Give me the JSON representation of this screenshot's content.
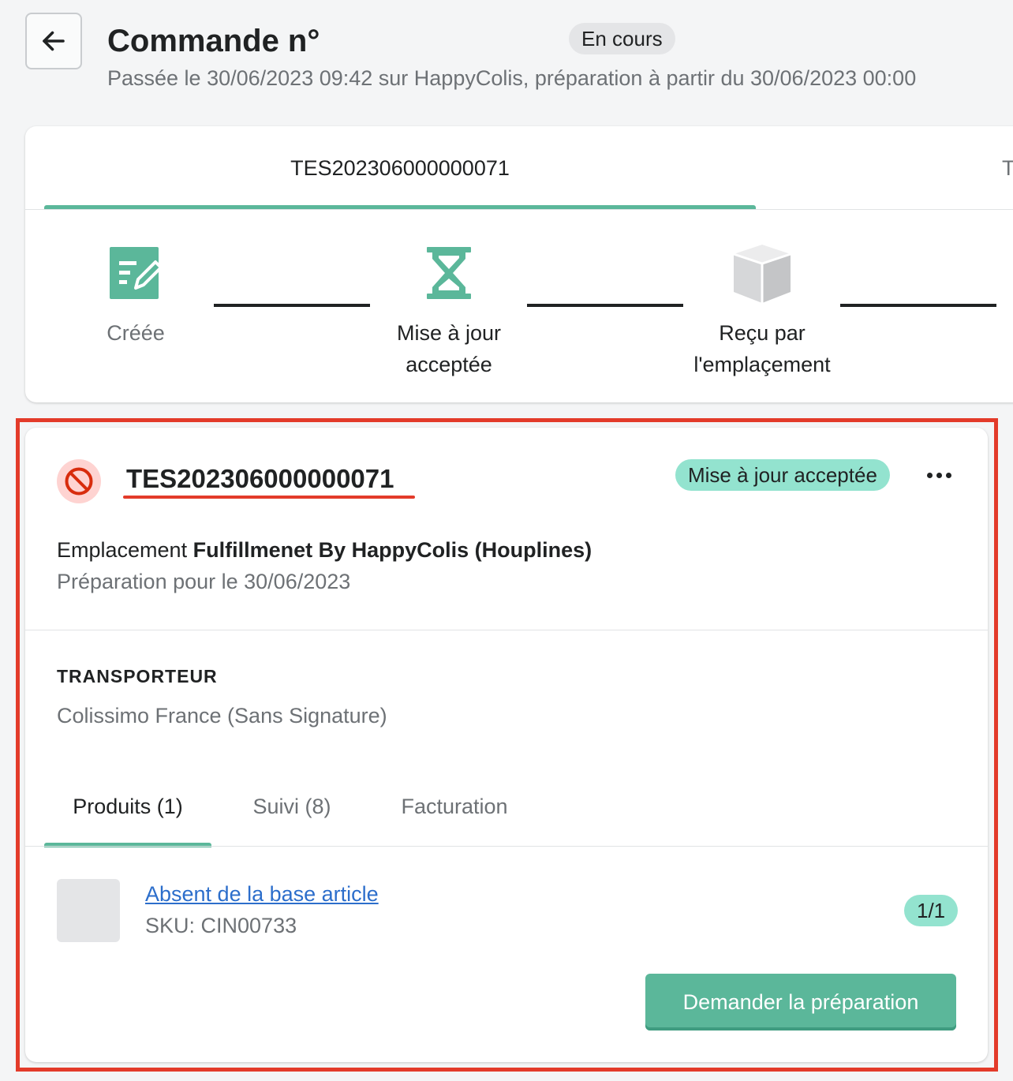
{
  "header": {
    "title": "Commande n°",
    "status_badge": "En cours",
    "subtitle": "Passée le 30/06/2023 09:42 sur HappyColis, préparation à partir du 30/06/2023 00:00"
  },
  "shipment_tabs": [
    {
      "label": "TES202306000000071",
      "active": true
    },
    {
      "label": "T",
      "active": false
    }
  ],
  "progress_steps": [
    {
      "label": "Créée",
      "icon": "edit-note-icon",
      "state": "done"
    },
    {
      "label_line1": "Mise à jour",
      "label_line2": "acceptée",
      "icon": "hourglass-icon",
      "state": "current"
    },
    {
      "label_line1": "Reçu par",
      "label_line2": "l'emplaçement",
      "icon": "package-box-icon",
      "state": "pending"
    }
  ],
  "shipment": {
    "status_icon": "blocked-icon",
    "reference": "TES202306000000071",
    "status_badge": "Mise à jour acceptée",
    "location_prefix": "Emplacement",
    "location_name": "Fulfillmenet By HappyColis (Houplines)",
    "preparation_date": "Préparation pour le 30/06/2023",
    "carrier_heading": "TRANSPORTEUR",
    "carrier_value": "Colissimo France (Sans Signature)",
    "tabs": [
      {
        "label": "Produits (1)",
        "active": true
      },
      {
        "label": "Suivi (8)",
        "active": false
      },
      {
        "label": "Facturation",
        "active": false
      }
    ],
    "product": {
      "name": "Absent de la base article",
      "sku": "SKU: CIN00733",
      "quantity": "1/1"
    },
    "action_button": "Demander la préparation"
  },
  "colors": {
    "accent": "#5bb79a",
    "success_badge": "#93e3cf",
    "highlight": "#e33b2a",
    "critical_bg": "#fed3d1"
  }
}
